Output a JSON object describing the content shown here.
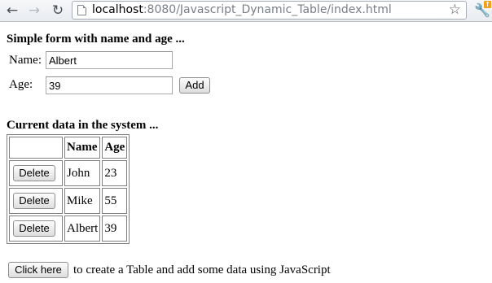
{
  "browser": {
    "url_host": "localhost",
    "url_path": ":8080/Javascript_Dynamic_Table/index.html",
    "icons": {
      "back": "back-arrow-icon",
      "forward": "forward-arrow-icon",
      "reload": "reload-icon",
      "bookmark": "star-icon",
      "menu": "wrench-icon"
    }
  },
  "form": {
    "heading": "Simple form with name and age ...",
    "name_label": "Name:",
    "name_value": "Albert",
    "age_label": "Age:",
    "age_value": "39",
    "add_label": "Add"
  },
  "data_section": {
    "heading": "Current data in the system ...",
    "columns": [
      "",
      "Name",
      "Age"
    ],
    "rows": [
      {
        "action": "Delete",
        "name": "John",
        "age": "23"
      },
      {
        "action": "Delete",
        "name": "Mike",
        "age": "55"
      },
      {
        "action": "Delete",
        "name": "Albert",
        "age": "39"
      }
    ]
  },
  "footer": {
    "button_label": "Click here",
    "text": "to create a Table and add some data using JavaScript"
  }
}
